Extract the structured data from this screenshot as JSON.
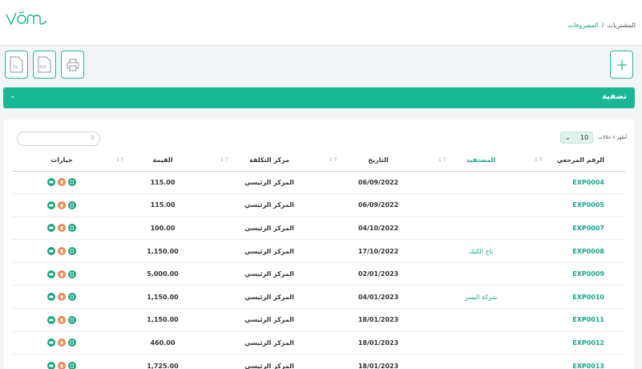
{
  "breadcrumb": {
    "section": "المشتريات",
    "separator": "/",
    "current": "المصروفات"
  },
  "toolbar": {
    "excel_label": "XL",
    "pdf_label": "PDF"
  },
  "filter": {
    "title": "تصفية"
  },
  "table_controls": {
    "show_label": "أظهر ٤ خلالات",
    "page_size": "10"
  },
  "colors": {
    "accent": "#18b795",
    "link": "#17a98c",
    "delete": "#f5844d"
  },
  "columns": {
    "ref": "الرقم المرجعي",
    "beneficiary": "المستفيد",
    "date": "التاريخ",
    "cost_center": "مركز التكلفة",
    "amount": "القيمة",
    "options": "خيارات"
  },
  "rows": [
    {
      "ref": "EXP0004",
      "beneficiary": "",
      "date": "06/09/2022",
      "cost_center": "المركز الرئيسي",
      "amount": "115.00"
    },
    {
      "ref": "EXP0005",
      "beneficiary": "",
      "date": "06/09/2022",
      "cost_center": "المركز الرئيسي",
      "amount": "115.00"
    },
    {
      "ref": "EXP0007",
      "beneficiary": "",
      "date": "04/10/2022",
      "cost_center": "المركز الرئيسي",
      "amount": "100.00"
    },
    {
      "ref": "EXP0008",
      "beneficiary": "تاج الكيك",
      "date": "17/10/2022",
      "cost_center": "المركز الرئيسي",
      "amount": "1,150.00"
    },
    {
      "ref": "EXP0009",
      "beneficiary": "",
      "date": "02/01/2023",
      "cost_center": "المركز الرئيسي",
      "amount": "5,000.00"
    },
    {
      "ref": "EXP0010",
      "beneficiary": "شركة اليسر",
      "date": "04/01/2023",
      "cost_center": "المركز الرئيسي",
      "amount": "1,150.00"
    },
    {
      "ref": "EXP0011",
      "beneficiary": "",
      "date": "18/01/2023",
      "cost_center": "المركز الرئيسي",
      "amount": "1,150.00"
    },
    {
      "ref": "EXP0012",
      "beneficiary": "",
      "date": "18/01/2023",
      "cost_center": "المركز الرئيسي",
      "amount": "460.00"
    },
    {
      "ref": "EXP0013",
      "beneficiary": "",
      "date": "18/01/2023",
      "cost_center": "المركز الرئيسي",
      "amount": "1,725.00"
    }
  ]
}
